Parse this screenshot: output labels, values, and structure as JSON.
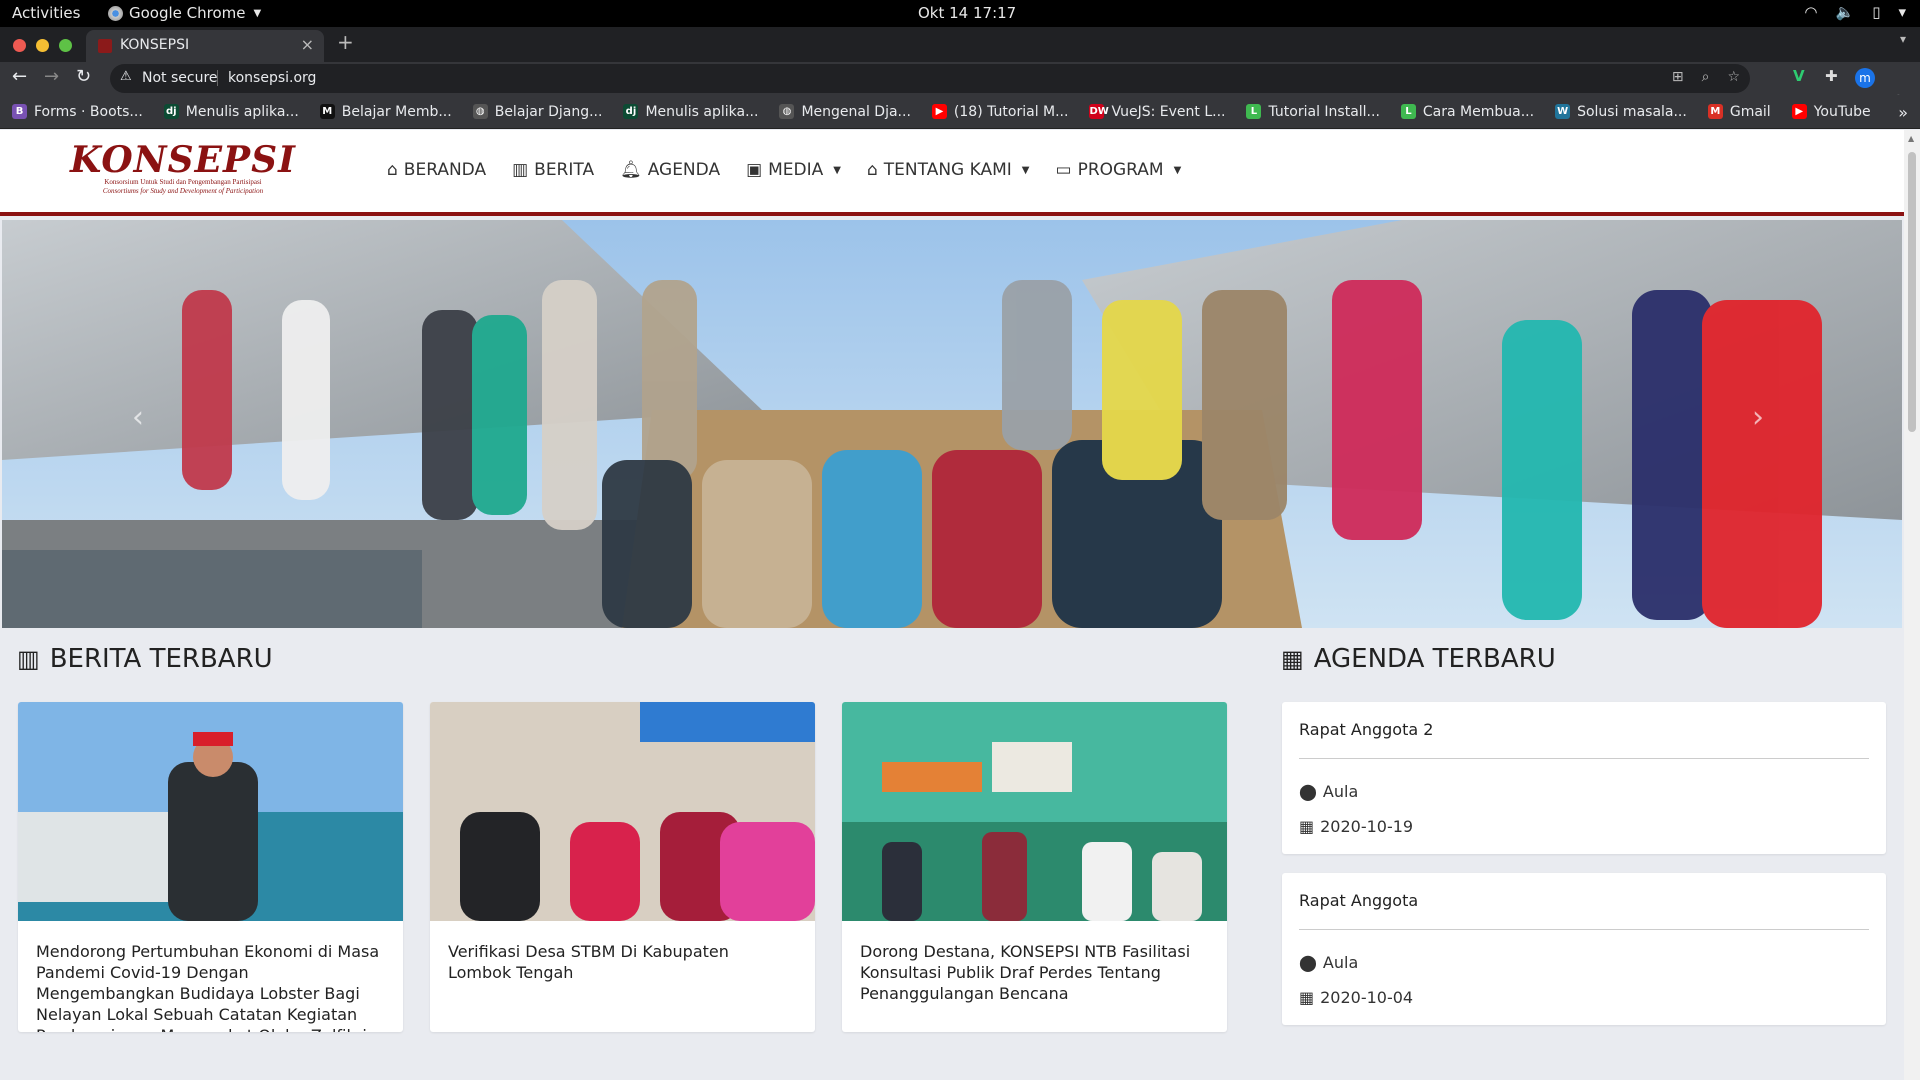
{
  "system": {
    "activities": "Activities",
    "app_name": "Google Chrome",
    "clock": "Okt 14  17:17"
  },
  "browser": {
    "tab_title": "KONSEPSI",
    "security_label": "Not secure",
    "url": "konsepsi.org",
    "profile_initial": "m",
    "bookmarks": [
      {
        "label": "Forms · Boots...",
        "icon": "B",
        "color": "#7952b3"
      },
      {
        "label": "Menulis aplika...",
        "icon": "dj",
        "color": "#0c4b33"
      },
      {
        "label": "Belajar Memb...",
        "icon": "M",
        "color": "#111111"
      },
      {
        "label": "Belajar Djang...",
        "icon": "globe",
        "color": "#555555"
      },
      {
        "label": "Menulis aplika...",
        "icon": "dj",
        "color": "#0c4b33"
      },
      {
        "label": "Mengenal Dja...",
        "icon": "globe",
        "color": "#555555"
      },
      {
        "label": "(18) Tutorial M...",
        "icon": "yt",
        "color": "#ff0000"
      },
      {
        "label": "VueJS: Event L...",
        "icon": "DW",
        "color": "#d0021b"
      },
      {
        "label": "Tutorial Install...",
        "icon": "L",
        "color": "#3fb950"
      },
      {
        "label": "Cara Membua...",
        "icon": "L",
        "color": "#3fb950"
      },
      {
        "label": "Solusi masala...",
        "icon": "W",
        "color": "#21759b"
      },
      {
        "label": "Gmail",
        "icon": "M",
        "color": "#d93025"
      },
      {
        "label": "YouTube",
        "icon": "yt",
        "color": "#ff0000"
      }
    ]
  },
  "site": {
    "logo_text": "KONSEPSI",
    "logo_sub1": "Konsorsium Untuk Studi dan Pengembangan Partisipasi",
    "logo_sub2": "Consortiums for Study and Development of Participation",
    "nav": [
      {
        "label": "BERANDA",
        "icon": "home-icon",
        "dropdown": false
      },
      {
        "label": "BERITA",
        "icon": "book-icon",
        "dropdown": false
      },
      {
        "label": "AGENDA",
        "icon": "bell-icon",
        "dropdown": false
      },
      {
        "label": "MEDIA",
        "icon": "images-icon",
        "dropdown": true
      },
      {
        "label": "TENTANG KAMI",
        "icon": "building-icon",
        "dropdown": true
      },
      {
        "label": "PROGRAM",
        "icon": "laptop-icon",
        "dropdown": true
      }
    ],
    "news_title": "BERITA TERBARU",
    "agenda_title": "AGENDA TERBARU",
    "news": [
      {
        "title": "Mendorong Pertumbuhan Ekonomi di Masa Pandemi Covid-19 Dengan Mengembangkan Budidaya Lobster Bagi Nelayan Lokal Sebuah Catatan Kegiatan Pendampingan Masyarakat Oleh : Zulfikri *)"
      },
      {
        "title": "Verifikasi Desa STBM Di Kabupaten Lombok Tengah"
      },
      {
        "title": "Dorong Destana, KONSEPSI NTB Fasilitasi Konsultasi Publik Draf Perdes Tentang Penanggulangan Bencana"
      }
    ],
    "agenda": [
      {
        "name": "Rapat Anggota 2",
        "location": "Aula",
        "date": "2020-10-19"
      },
      {
        "name": "Rapat Anggota",
        "location": "Aula",
        "date": "2020-10-04"
      }
    ]
  },
  "colors": {
    "brand": "#8b1212",
    "page_bg": "#e9ebf0"
  }
}
